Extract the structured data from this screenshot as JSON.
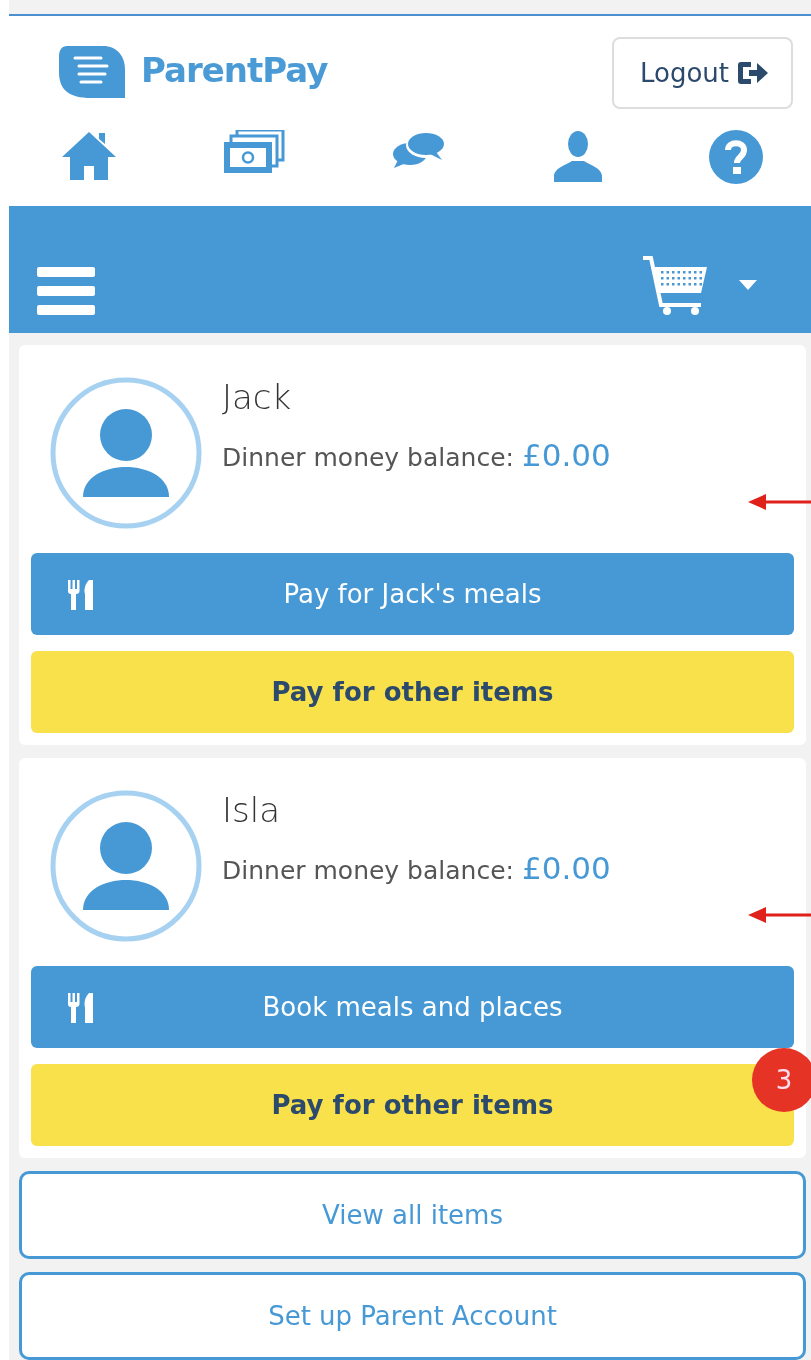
{
  "header": {
    "logo_text": "ParentPay",
    "logout_button": "Logout"
  },
  "nav_icons": [
    {
      "kind": "home"
    },
    {
      "kind": "payments"
    },
    {
      "kind": "messages"
    },
    {
      "kind": "profile"
    },
    {
      "kind": "help"
    }
  ],
  "children": [
    {
      "name": "Jack",
      "balance_label": "Dinner money balance:",
      "balance": "£0.00",
      "meals_button": "Pay for Jack's meals",
      "other_button": "Pay for other items",
      "annotated": true
    },
    {
      "name": "Isla",
      "balance_label": "Dinner money balance:",
      "balance": "£0.00",
      "meals_button": "Book meals and places",
      "other_button": "Pay for other items",
      "annotated": true,
      "badge": "3"
    }
  ],
  "buttons": [
    "View all items",
    "Set up Parent Account"
  ]
}
